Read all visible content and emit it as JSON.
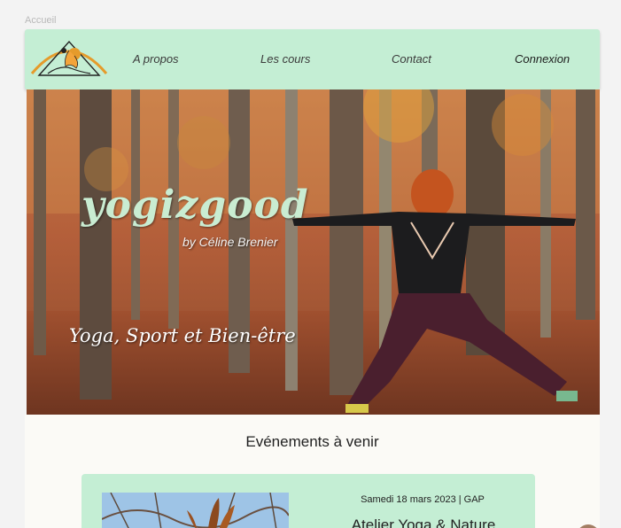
{
  "breadcrumb": "Accueil",
  "nav": {
    "items": [
      {
        "label": "A propos"
      },
      {
        "label": "Les cours"
      },
      {
        "label": "Contact"
      },
      {
        "label": "Connexion"
      }
    ]
  },
  "hero": {
    "brand": "yogizgood",
    "byline": "by Céline Brenier",
    "tagline": "Yoga, Sport et Bien-être"
  },
  "events": {
    "title": "Evénements à venir",
    "items": [
      {
        "date": "Samedi 18 mars 2023 | GAP",
        "name": "Atelier Yoga & Nature"
      }
    ]
  },
  "colors": {
    "nav_bg": "#c4eed4",
    "page_bg": "#f3f3f3",
    "content_bg": "#fbfaf6",
    "logo_accent": "#e59b2b"
  }
}
